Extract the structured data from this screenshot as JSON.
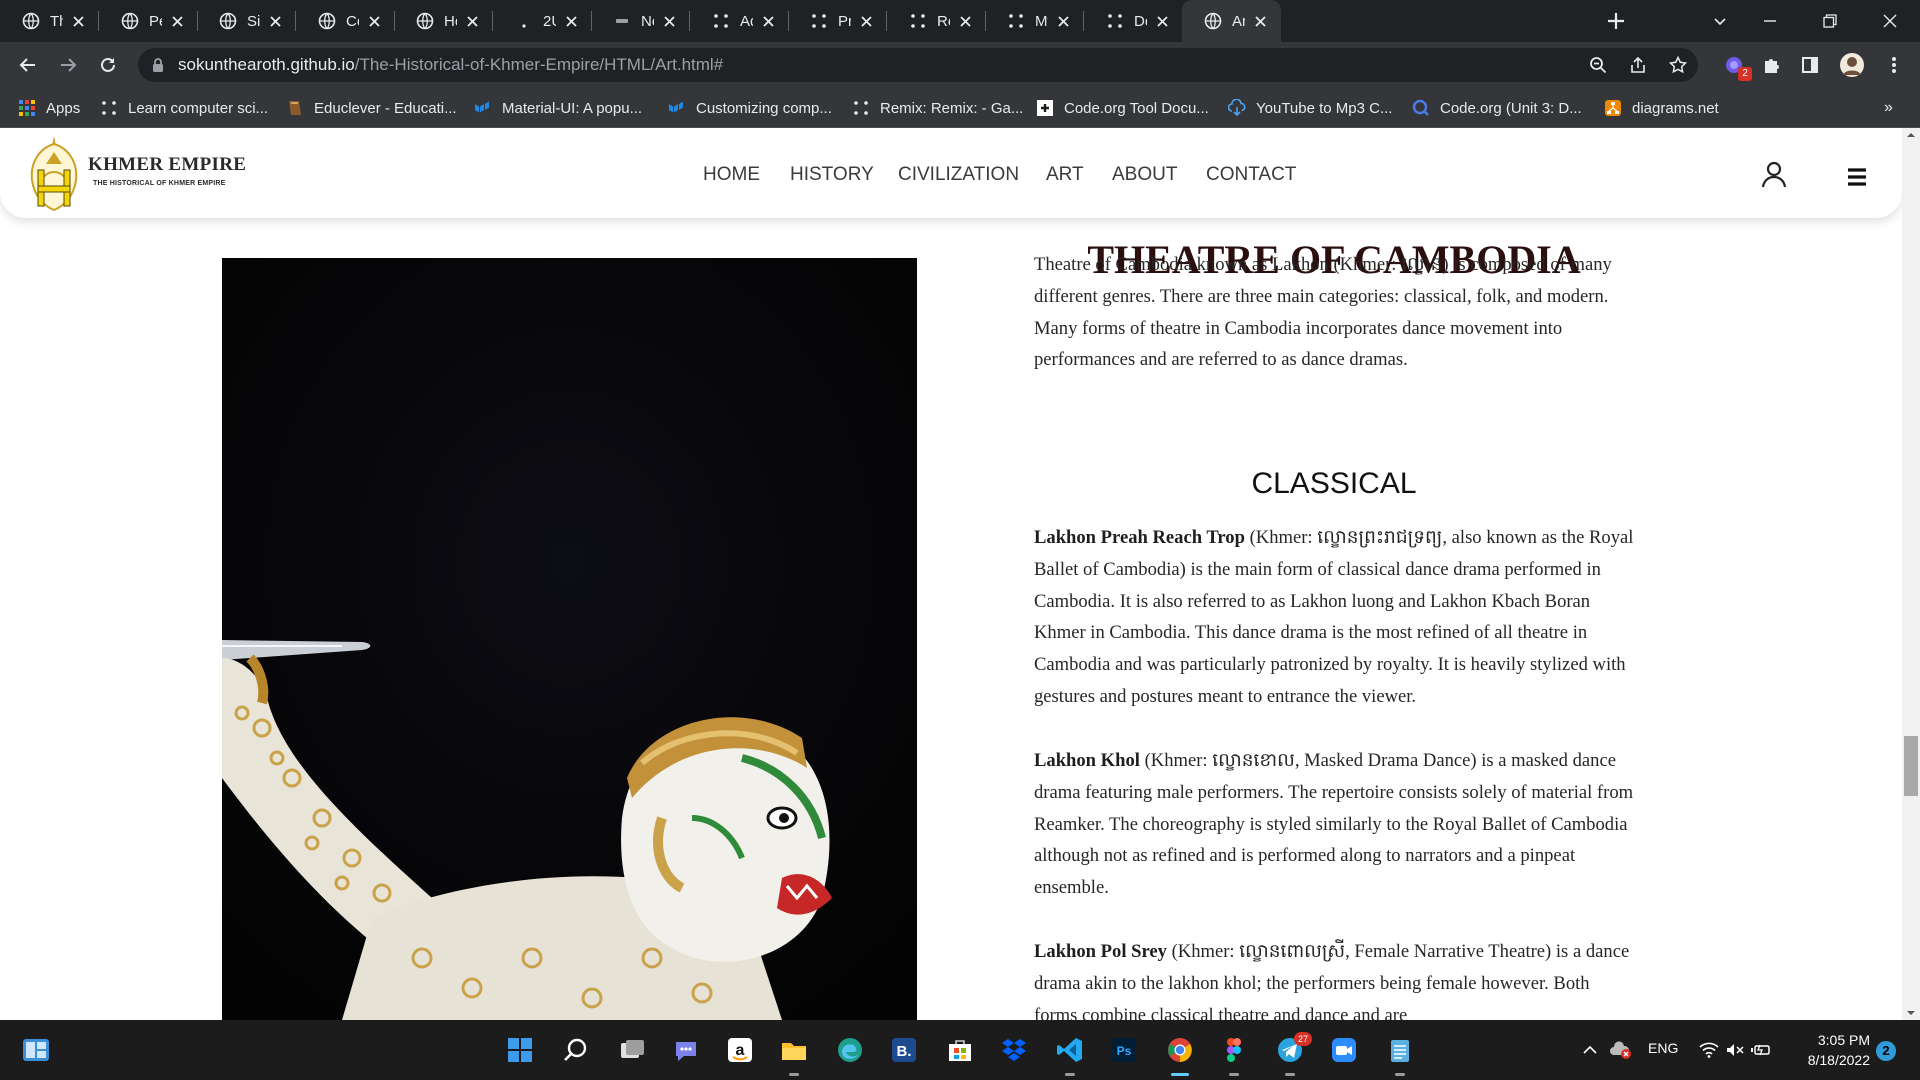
{
  "browser": {
    "tabs": [
      {
        "title": "Three",
        "icon": "globe-icon"
      },
      {
        "title": "Persor",
        "icon": "globe-icon"
      },
      {
        "title": "Sign U",
        "icon": "globe-icon"
      },
      {
        "title": "Conta",
        "icon": "globe-icon"
      },
      {
        "title": "Home",
        "icon": "globe-icon"
      },
      {
        "title": "2U",
        "icon": "twou-icon"
      },
      {
        "title": "Next S",
        "icon": "nextstep-icon"
      },
      {
        "title": "Adven",
        "icon": "dots-icon"
      },
      {
        "title": "Projec",
        "icon": "dots-icon"
      },
      {
        "title": "Remix",
        "icon": "dots-icon"
      },
      {
        "title": "My litt",
        "icon": "dots-icon"
      },
      {
        "title": "Demo",
        "icon": "dots-icon"
      },
      {
        "title": "Art Pa",
        "icon": "globe-icon",
        "active": true
      }
    ],
    "url_host": "sokunthearoth.github.io",
    "url_path": "/The-Historical-of-Khmer-Empire/HTML/Art.html#",
    "extension_badge": "2",
    "bookmarks": [
      {
        "label": "Apps",
        "icon": "apps-grid-icon"
      },
      {
        "label": "Learn computer sci...",
        "icon": "dots-icon"
      },
      {
        "label": "Educlever - Educati...",
        "icon": "book-icon"
      },
      {
        "label": "Material-UI: A popu...",
        "icon": "mui-icon"
      },
      {
        "label": "Customizing comp...",
        "icon": "mui-icon"
      },
      {
        "label": "Remix: Remix: - Ga...",
        "icon": "dots-icon"
      },
      {
        "label": "Code.org Tool Docu...",
        "icon": "codeorg-icon"
      },
      {
        "label": "YouTube to Mp3 C...",
        "icon": "download-cloud-icon"
      },
      {
        "label": "Code.org (Unit 3: D...",
        "icon": "search-icon"
      },
      {
        "label": "diagrams.net",
        "icon": "diagrams-icon"
      }
    ],
    "more_bookmarks": "»"
  },
  "site": {
    "brand": "KHMER EMPIRE",
    "tagline": "THE HISTORICAL OF KHMER EMPIRE",
    "menu": [
      "HOME",
      "HISTORY",
      "CIVILIZATION",
      "ART",
      "ABOUT",
      "CONTACT"
    ],
    "photo_alt": "Masked Khmer dancer in ornate white costume holding a sword"
  },
  "article": {
    "title": "THEATRE OF CAMBODIA",
    "intro": "Theatre of Cambodia known as Lakhon (Khmer: ល្ខោន) is composed of many different genres. There are three main categories: classical, folk, and modern. Many forms of theatre in Cambodia incorporates dance movement into performances and are referred to as dance dramas.",
    "subtitle": "CLASSICAL",
    "p1_bold": "Lakhon Preah Reach Trop",
    "p1_text": " (Khmer: ល្ខោនព្រះរាជទ្រព្យ, also known as the Royal Ballet of Cambodia) is the main form of classical dance drama performed in Cambodia. It is also referred to as Lakhon luong and Lakhon Kbach Boran Khmer in Cambodia. This dance drama is the most refined of all theatre in Cambodia and was particularly patronized by royalty. It is heavily stylized with gestures and postures meant to entrance the viewer.",
    "p2_bold": "Lakhon Khol",
    "p2_text": " (Khmer: ល្ខោនខោល, Masked Drama Dance) is a masked dance drama featuring male performers. The repertoire consists solely of material from Reamker. The choreography is styled similarly to the Royal Ballet of Cambodia although not as refined and is performed along to narrators and a pinpeat ensemble.",
    "p3_bold": "Lakhon Pol Srey",
    "p3_text": " (Khmer: ល្ខោនពោលស្រី, Female Narrative Theatre) is a dance drama akin to the lakhon khol; the performers being female however. Both forms combine classical theatre and dance and are"
  },
  "taskbar": {
    "apps": [
      "start-icon",
      "search-icon",
      "task-view-icon",
      "teams-chat-icon",
      "amazon-icon",
      "file-explorer-icon",
      "edge-icon",
      "bing-icon",
      "store-icon",
      "dropbox-icon",
      "vscode-icon",
      "photoshop-icon",
      "chrome-icon",
      "figma-icon",
      "telegram-icon",
      "zoom-icon",
      "notepad-icon"
    ],
    "telegram_badge": "27",
    "language": "ENG",
    "time": "3:05 PM",
    "date": "8/18/2022",
    "notifications": "2",
    "colors": {
      "accent": "#0078d4",
      "taskbar": "#1c1c1c"
    }
  }
}
